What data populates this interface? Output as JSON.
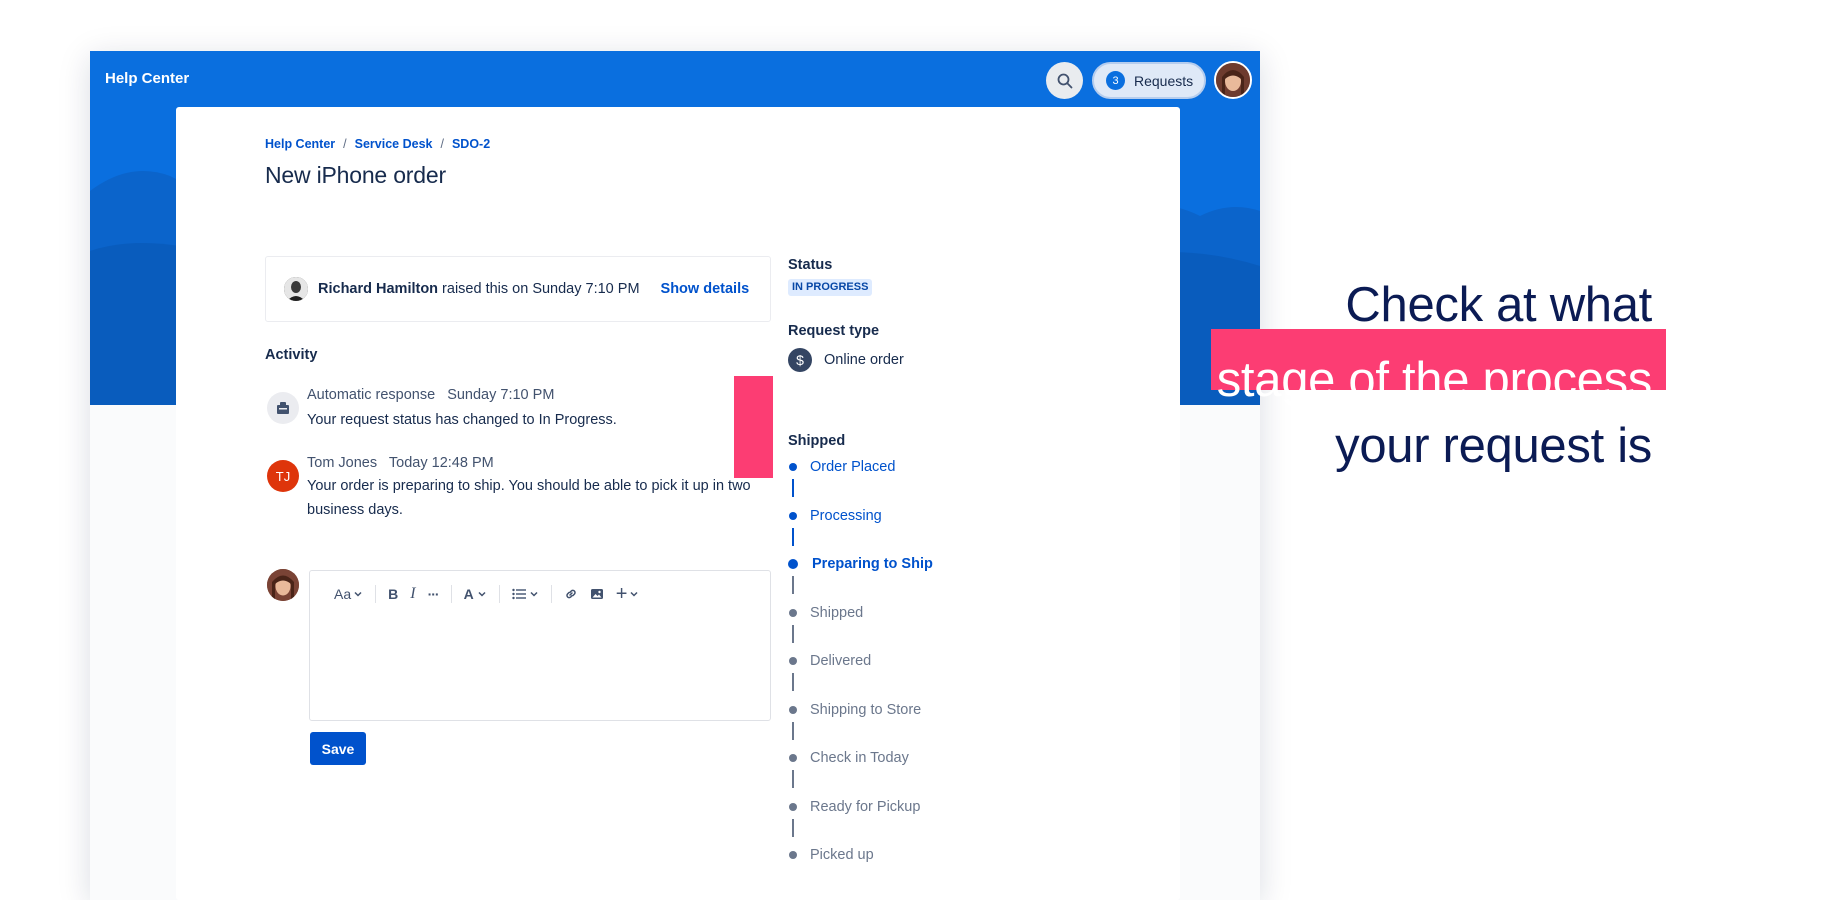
{
  "topbar": {
    "site_title": "Help Center",
    "requests_count": "3",
    "requests_label": "Requests"
  },
  "breadcrumb": [
    "Help Center",
    "Service Desk",
    "SDO-2"
  ],
  "breadcrumb_sep": "/",
  "request": {
    "title": "New iPhone order",
    "raised_by": "Richard Hamilton",
    "raised_text": "raised this on Sunday 7:10 PM",
    "show_details": "Show details"
  },
  "activity": {
    "heading": "Activity",
    "items": [
      {
        "author": "Automatic response",
        "time": "Sunday 7:10 PM",
        "text": "Your request status has changed to In Progress."
      },
      {
        "author": "Tom Jones",
        "initials": "TJ",
        "time": "Today 12:48 PM",
        "text": "Your order is preparing to ship. You should be able to pick it up in two business days."
      }
    ]
  },
  "editor": {
    "text_style": "Aa",
    "bold": "B",
    "italic": "I",
    "more": "···",
    "color": "A",
    "add": "+",
    "save_label": "Save"
  },
  "sidebar": {
    "status_label": "Status",
    "status_value": "IN PROGRESS",
    "request_type_label": "Request type",
    "request_type_icon": "$",
    "request_type_value": "Online order",
    "timeline_label": "Shipped",
    "steps": [
      {
        "label": "Order Placed",
        "state": "done"
      },
      {
        "label": "Processing",
        "state": "done"
      },
      {
        "label": "Preparing to Ship",
        "state": "current"
      },
      {
        "label": "Shipped",
        "state": "pending"
      },
      {
        "label": "Delivered",
        "state": "pending"
      },
      {
        "label": "Shipping to Store",
        "state": "pending"
      },
      {
        "label": "Check in Today",
        "state": "pending"
      },
      {
        "label": "Ready for Pickup",
        "state": "pending"
      },
      {
        "label": "Picked up",
        "state": "pending"
      }
    ]
  },
  "headline": {
    "line1": "Check at what",
    "line2": "stage of the process",
    "line3": "your request is"
  },
  "colors": {
    "brand_blue": "#0a6fdf",
    "link_blue": "#0052cc",
    "accent_pink": "#fc3d73",
    "pending_gray": "#6b778c",
    "headline_navy": "#0b1b54"
  }
}
